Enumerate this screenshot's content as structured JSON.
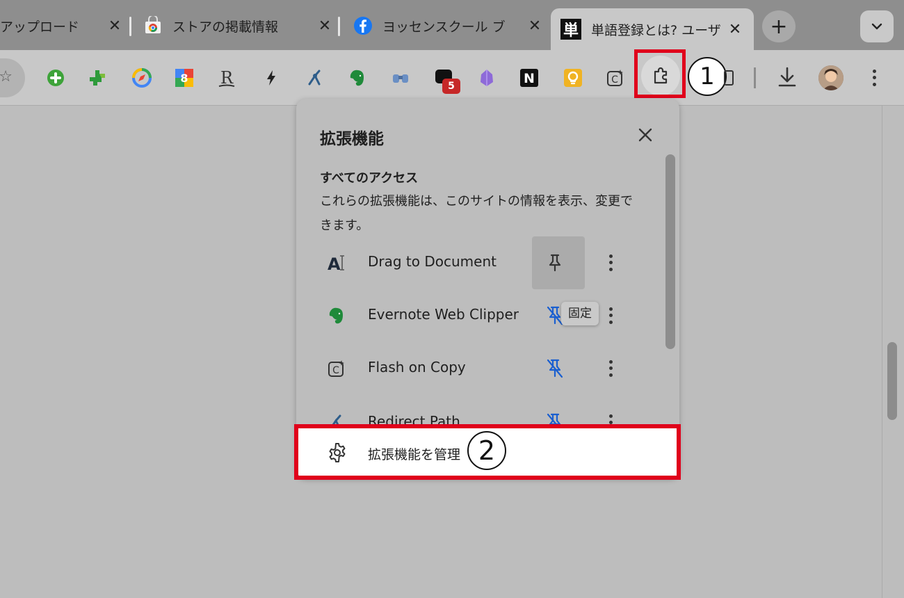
{
  "tabs": [
    {
      "title": "アップロード",
      "favicon": "none",
      "active": false
    },
    {
      "title": "ストアの掲載情報",
      "favicon": "chrome-web-store-icon",
      "active": false
    },
    {
      "title": "ヨッセンスクール ブ",
      "favicon": "facebook-icon",
      "active": false
    },
    {
      "title": "単語登録とは? ユーザ",
      "favicon": "tango-icon",
      "favicon_text": "単",
      "active": true
    }
  ],
  "tab_close_glyph": "✕",
  "new_tab_glyph": "+",
  "extension_badge": "5",
  "callouts": {
    "one": "1",
    "two": "2"
  },
  "popup": {
    "title": "拡張機能",
    "section_heading": "すべてのアクセス",
    "section_description": "これらの拡張機能は、このサイトの情報を表示、変更できます。",
    "extensions": [
      {
        "name": "Drag to Document",
        "icon": "drag-to-document-icon",
        "pinned": true
      },
      {
        "name": "Evernote Web Clipper",
        "icon": "evernote-icon",
        "pinned": false
      },
      {
        "name": "Flash on Copy",
        "icon": "flash-on-copy-icon",
        "pinned": false
      },
      {
        "name": "Redirect Path",
        "icon": "redirect-path-icon",
        "pinned": false
      }
    ],
    "tooltip": "固定",
    "manage_label": "拡張機能を管理"
  },
  "colors": {
    "highlight": "#e0001b",
    "pin_blue": "#1a5fd0",
    "badge_red": "#c62828"
  }
}
